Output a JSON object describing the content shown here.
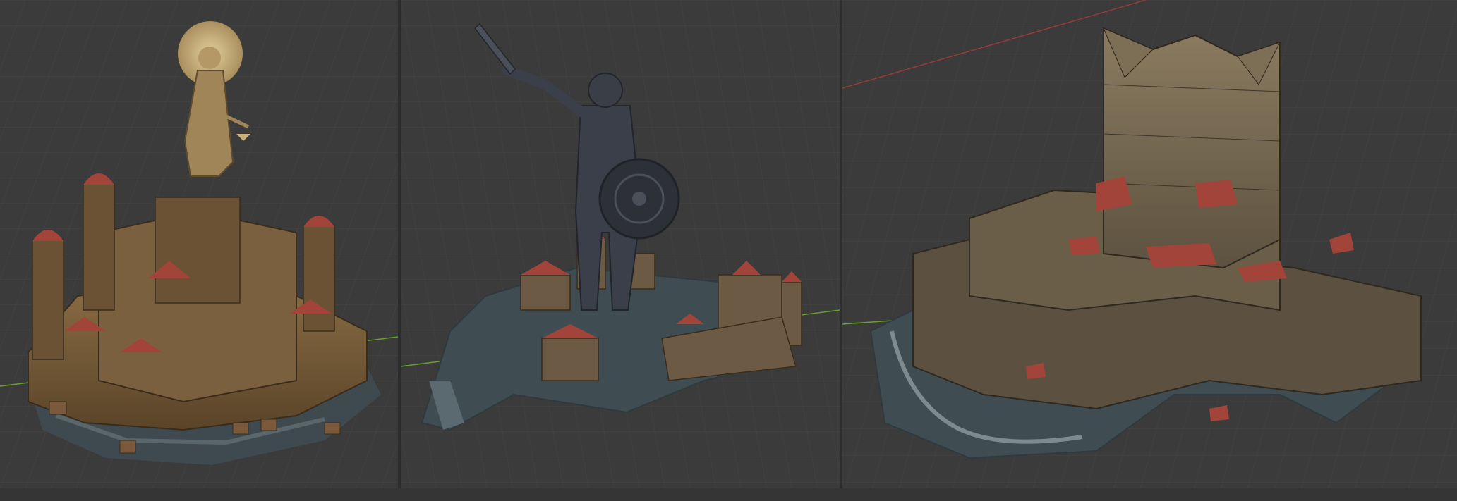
{
  "scene": {
    "viewport_count": 3,
    "colors": {
      "background": "#3a3a3a",
      "grid": "#444444",
      "axis_x": "#9e3a3a",
      "axis_y": "#6aa02c",
      "stone": "#7a5f3c",
      "roof": "#a2443a",
      "ground": "#3f4d52",
      "statue_gold": "#b69a6b",
      "statue_dark": "#3b3f49"
    },
    "viewports": [
      {
        "name": "golden-cathedral-city",
        "subject": "statue-of-justice"
      },
      {
        "name": "knight-statue-town",
        "subject": "knight-statue"
      },
      {
        "name": "stone-fortress",
        "subject": "tower-fortress"
      }
    ]
  }
}
